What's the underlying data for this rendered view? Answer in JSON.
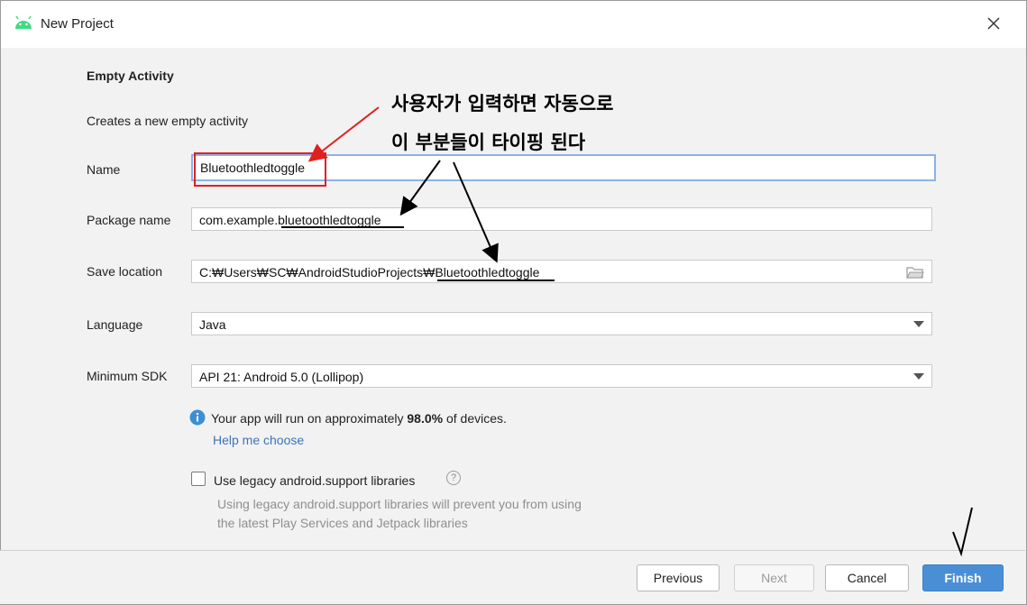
{
  "window": {
    "title": "New Project",
    "icon": "android-icon",
    "close_icon": "close-icon"
  },
  "main": {
    "heading": "Empty Activity",
    "subtitle": "Creates a new empty activity",
    "name": {
      "label": "Name",
      "value": "Bluetoothledtoggle"
    },
    "package": {
      "label": "Package name",
      "value": "com.example.bluetoothledtoggle"
    },
    "save_location": {
      "label": "Save location",
      "value": "C:₩Users₩SC₩AndroidStudioProjects₩Bluetoothledtoggle"
    },
    "language": {
      "label": "Language",
      "value": "Java"
    },
    "min_sdk": {
      "label": "Minimum SDK",
      "value": "API 21: Android 5.0 (Lollipop)"
    },
    "info": {
      "prefix": "Your app will run on approximately ",
      "percent": "98.0%",
      "suffix": " of devices."
    },
    "help_link": "Help me choose",
    "legacy": {
      "label": "Use legacy android.support libraries",
      "checked": false,
      "desc_line1": "Using legacy android.support libraries will prevent you from using",
      "desc_line2": "the latest Play Services and Jetpack libraries"
    }
  },
  "footer": {
    "previous": "Previous",
    "next": "Next",
    "cancel": "Cancel",
    "finish": "Finish"
  },
  "annotations": {
    "line1": "사용자가 입력하면 자동으로",
    "line2": "이 부분들이 타이핑 된다"
  },
  "colors": {
    "android_green": "#3ddc84",
    "finish_blue": "#4a8fd6",
    "link_blue": "#3d73b9",
    "annotation_red": "#e02020"
  }
}
